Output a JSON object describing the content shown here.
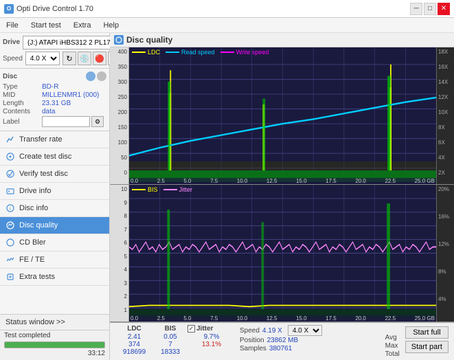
{
  "titleBar": {
    "icon": "O",
    "title": "Opti Drive Control 1.70",
    "controls": [
      "minimize",
      "maximize",
      "close"
    ]
  },
  "menuBar": {
    "items": [
      "File",
      "Start test",
      "Extra",
      "Help"
    ]
  },
  "drive": {
    "label": "Drive",
    "driveValue": "(J:) ATAPI iHBS312  2 PL17",
    "speedLabel": "Speed",
    "speedValue": "4.0 X"
  },
  "disc": {
    "title": "Disc",
    "typeLabel": "Type",
    "typeValue": "BD-R",
    "midLabel": "MID",
    "midValue": "MILLENMR1 (000)",
    "lengthLabel": "Length",
    "lengthValue": "23.31 GB",
    "contentsLabel": "Contents",
    "contentsValue": "data",
    "labelLabel": "Label",
    "labelValue": ""
  },
  "navItems": [
    {
      "id": "transfer-rate",
      "label": "Transfer rate",
      "icon": "chart"
    },
    {
      "id": "create-test-disc",
      "label": "Create test disc",
      "icon": "disc"
    },
    {
      "id": "verify-test-disc",
      "label": "Verify test disc",
      "icon": "verify"
    },
    {
      "id": "drive-info",
      "label": "Drive info",
      "icon": "info"
    },
    {
      "id": "disc-info",
      "label": "Disc info",
      "icon": "disc-info"
    },
    {
      "id": "disc-quality",
      "label": "Disc quality",
      "icon": "quality",
      "active": true
    },
    {
      "id": "cd-bler",
      "label": "CD Bler",
      "icon": "cd"
    },
    {
      "id": "fe-te",
      "label": "FE / TE",
      "icon": "fe"
    },
    {
      "id": "extra-tests",
      "label": "Extra tests",
      "icon": "extra"
    }
  ],
  "statusWindow": {
    "label": "Status window >>",
    "completed": "Test completed",
    "progress": 100,
    "time": "33:12"
  },
  "discQuality": {
    "title": "Disc quality",
    "chart1": {
      "legend": [
        {
          "label": "LDC",
          "color": "#ffff00"
        },
        {
          "label": "Read speed",
          "color": "#00ccff"
        },
        {
          "label": "Write speed",
          "color": "#ff00ff"
        }
      ],
      "yMax": 400,
      "yLabels": [
        "400",
        "350",
        "300",
        "250",
        "200",
        "150",
        "100",
        "50",
        "0"
      ],
      "yLabelsRight": [
        "18X",
        "16X",
        "14X",
        "12X",
        "10X",
        "8X",
        "6X",
        "4X",
        "2X"
      ],
      "xLabels": [
        "0.0",
        "2.5",
        "5.0",
        "7.5",
        "10.0",
        "12.5",
        "15.0",
        "17.5",
        "20.0",
        "22.5",
        "25.0 GB"
      ]
    },
    "chart2": {
      "legend": [
        {
          "label": "BIS",
          "color": "#ffff00"
        },
        {
          "label": "Jitter",
          "color": "#ff88ff"
        }
      ],
      "yMax": 10,
      "yLabels": [
        "10",
        "9",
        "8",
        "7",
        "6",
        "5",
        "4",
        "3",
        "2",
        "1"
      ],
      "yLabelsRight": [
        "20%",
        "16%",
        "12%",
        "8%",
        "4%"
      ],
      "xLabels": [
        "0.0",
        "2.5",
        "5.0",
        "7.5",
        "10.0",
        "12.5",
        "15.0",
        "17.5",
        "20.0",
        "22.5",
        "25.0 GB"
      ]
    }
  },
  "stats": {
    "ldcHeader": "LDC",
    "bisHeader": "BIS",
    "jitterHeader": "Jitter",
    "jitterChecked": true,
    "avgLabel": "Avg",
    "maxLabel": "Max",
    "totalLabel": "Total",
    "ldcAvg": "2.41",
    "ldcMax": "374",
    "ldcTotal": "918699",
    "bisAvg": "0.05",
    "bisMax": "7",
    "bisTotal": "18333",
    "jitterAvg": "9.7%",
    "jitterMax": "13.1%",
    "jitterMaxColor": "red",
    "speedLabel": "Speed",
    "speedValue": "4.19 X",
    "speedSelect": "4.0 X",
    "positionLabel": "Position",
    "positionValue": "23862 MB",
    "samplesLabel": "Samples",
    "samplesValue": "380761",
    "startFullBtn": "Start full",
    "startPartBtn": "Start part"
  }
}
